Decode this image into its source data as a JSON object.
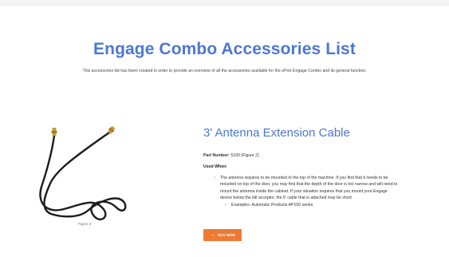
{
  "header": {
    "title": "Engage Combo Accessories List",
    "intro": "This accessories list has been created in order to provide an overview of all the accessories available for the ePort Engage Combo and its general function."
  },
  "product": {
    "image_icon": "antenna-cable-image",
    "figure_caption": "Figure 2",
    "title": "3' Antenna Extension Cable",
    "part_label": "Part Number:",
    "part_value": "5100 (Figure 2)",
    "used_when_label": "Used When:",
    "used_when_lines": [
      "The antenna requires to be mounted to the top of the machine. If you find that it needs to be",
      "mounted on top of the door, you may find that the depth of the door is too narrow and will need to",
      "mount the antenna inside the cabinet. If your situation requires that you mount your Engage",
      "device below the bill acceptor, the 6' cable that is attached may be short"
    ],
    "example": "Examples: Automatic Products AP100 series",
    "bullet_icon": "chevron-right-icon",
    "buy_button": {
      "label": "BUY NOW",
      "icon": "arrow-right-icon",
      "color": "#ee7a33"
    }
  },
  "colors": {
    "accent": "#4d77d4",
    "bullet": "#d9541e"
  }
}
